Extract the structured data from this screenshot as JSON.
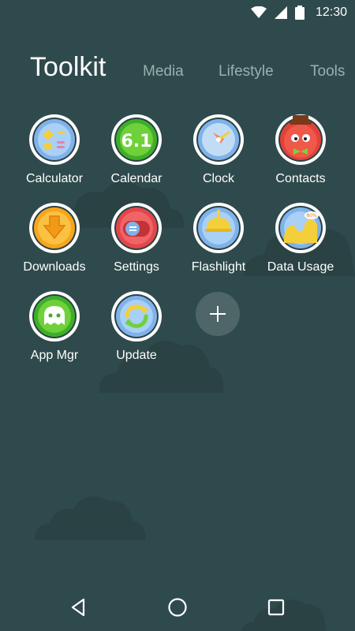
{
  "status_bar": {
    "time": "12:30",
    "icons": [
      "wifi-icon",
      "signal-icon",
      "battery-icon"
    ]
  },
  "tabs": [
    {
      "label": "Toolkit",
      "active": true
    },
    {
      "label": "Media",
      "active": false
    },
    {
      "label": "Lifestyle",
      "active": false
    },
    {
      "label": "Tools",
      "active": false
    }
  ],
  "apps": [
    {
      "label": "Calculator",
      "icon": "calculator-icon"
    },
    {
      "label": "Calendar",
      "icon": "calendar-icon"
    },
    {
      "label": "Clock",
      "icon": "clock-icon"
    },
    {
      "label": "Contacts",
      "icon": "contacts-icon"
    },
    {
      "label": "Downloads",
      "icon": "downloads-icon"
    },
    {
      "label": "Settings",
      "icon": "settings-icon"
    },
    {
      "label": "Flashlight",
      "icon": "flashlight-icon"
    },
    {
      "label": "Data Usage",
      "icon": "data-usage-icon"
    },
    {
      "label": "App Mgr",
      "icon": "app-manager-icon"
    },
    {
      "label": "Update",
      "icon": "update-icon"
    }
  ],
  "add_button": {
    "icon": "plus-icon"
  },
  "calendar_icon_text": "6.1",
  "data_usage_icon_text": "80%",
  "nav_bar": {
    "icons": [
      "back-icon",
      "home-icon",
      "recents-icon"
    ]
  },
  "colors": {
    "background": "#2f4a4c",
    "tab_inactive": "#9ab0ae",
    "add_button": "#4e6668"
  }
}
